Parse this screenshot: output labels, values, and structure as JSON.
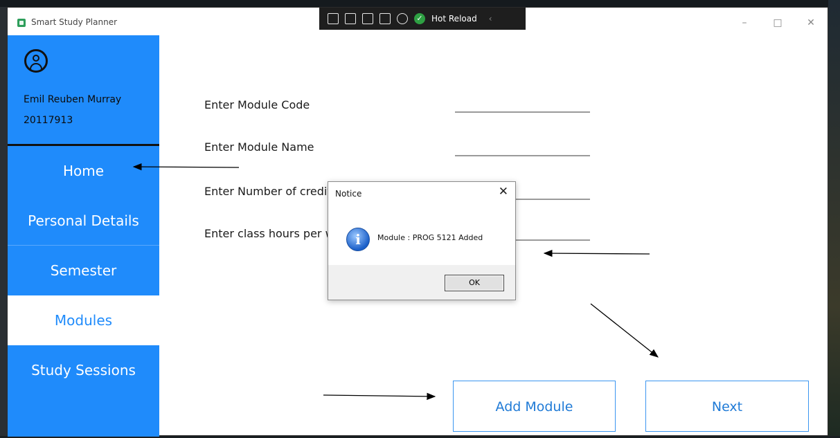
{
  "window": {
    "title": "Smart Study Planner",
    "minimize_icon": "–",
    "maximize_icon": "□",
    "close_icon": "✕"
  },
  "debug_toolbar": {
    "hot_reload_label": "Hot Reload",
    "collapse_icon": "‹"
  },
  "sidebar": {
    "user_name": "Emil Reuben Murray",
    "user_id": "20117913",
    "items": [
      {
        "label": "Home"
      },
      {
        "label": "Personal Details"
      },
      {
        "label": "Semester"
      },
      {
        "label": "Modules"
      },
      {
        "label": "Study Sessions"
      }
    ],
    "active_item": "Modules",
    "accent_color": "#1f8bfb"
  },
  "form": {
    "module_code_label": "Enter Module Code",
    "module_name_label": "Enter Module Name",
    "credits_label": "Enter Number of credits",
    "class_hours_label": "Enter class hours per week"
  },
  "buttons": {
    "add_module": "Add Module",
    "next": "Next"
  },
  "dialog": {
    "title": "Notice",
    "close_icon": "✕",
    "info_glyph": "i",
    "message": "Module : PROG 5121 Added",
    "ok_label": "OK"
  }
}
